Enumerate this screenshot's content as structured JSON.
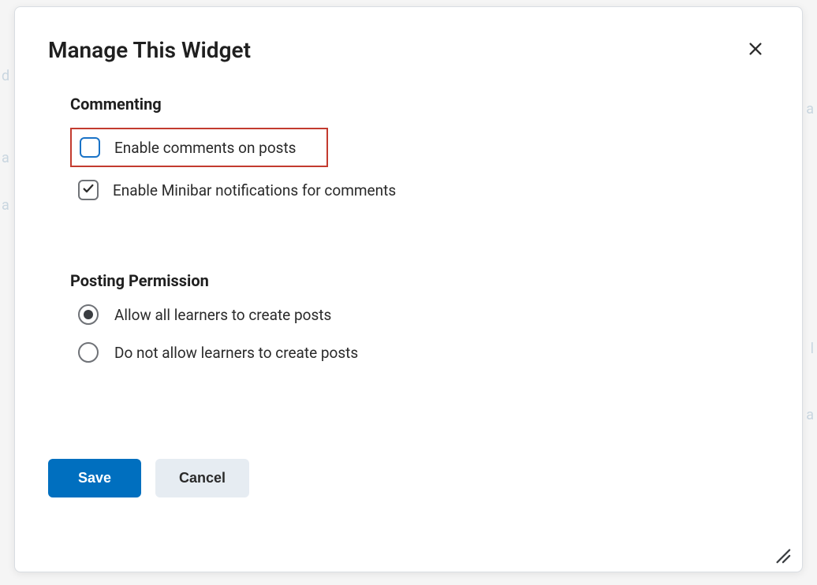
{
  "dialog": {
    "title": "Manage This Widget",
    "sections": {
      "commenting": {
        "heading": "Commenting",
        "options": {
          "enable_comments": "Enable comments on posts",
          "enable_minibar": "Enable Minibar notifications for comments"
        }
      },
      "posting": {
        "heading": "Posting Permission",
        "options": {
          "allow_all": "Allow all learners to create posts",
          "do_not_allow": "Do not allow learners to create posts"
        }
      }
    },
    "footer": {
      "save_label": "Save",
      "cancel_label": "Cancel"
    }
  }
}
